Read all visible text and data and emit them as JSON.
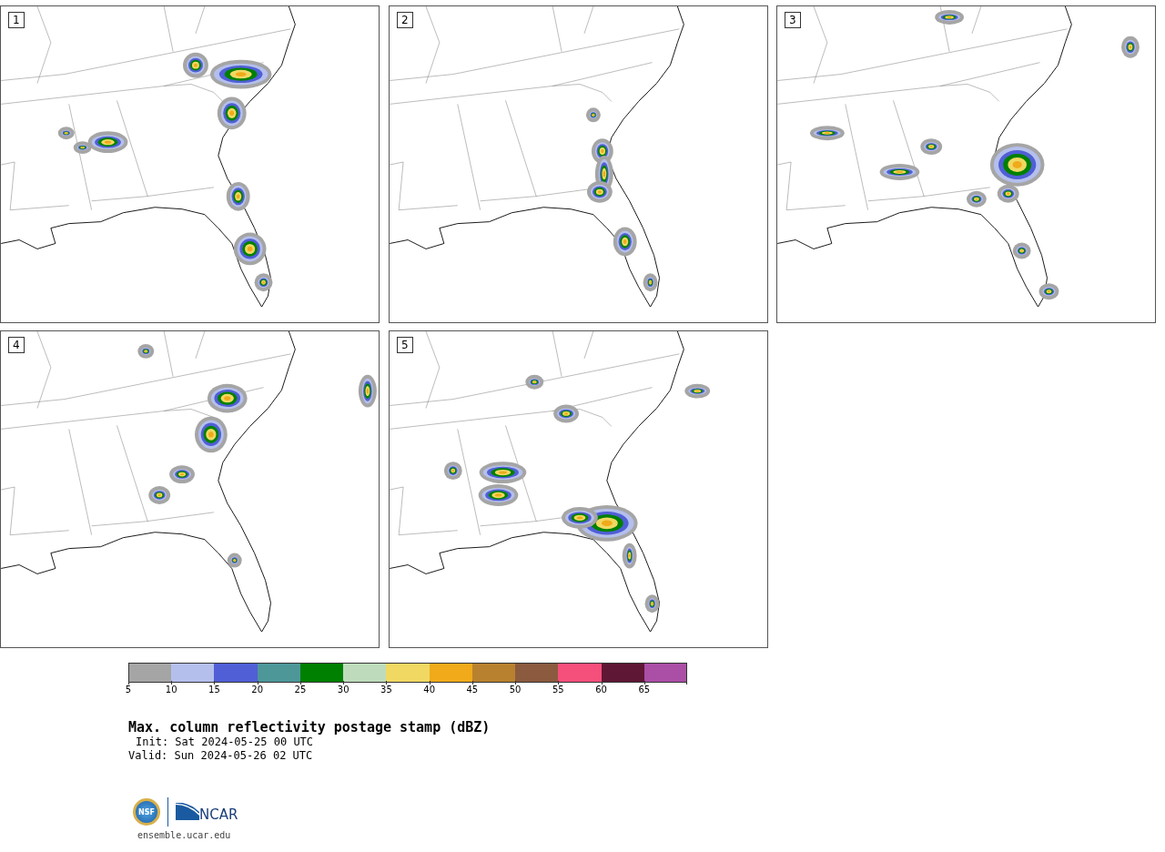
{
  "panels": [
    {
      "number": "1"
    },
    {
      "number": "2"
    },
    {
      "number": "3"
    },
    {
      "number": "4"
    },
    {
      "number": "5"
    }
  ],
  "colorbar": {
    "segments": [
      {
        "color": "#a5a5a5"
      },
      {
        "color": "#b4bfec"
      },
      {
        "color": "#505fd6"
      },
      {
        "color": "#4e9799"
      },
      {
        "color": "#008000"
      },
      {
        "color": "#bedcbb"
      },
      {
        "color": "#f0d862"
      },
      {
        "color": "#f0aa1a"
      },
      {
        "color": "#b8812f"
      },
      {
        "color": "#8b5a3f"
      },
      {
        "color": "#f54f7b"
      },
      {
        "color": "#5e1734"
      },
      {
        "color": "#aa4ea6"
      }
    ],
    "tick_labels": [
      "5",
      "10",
      "15",
      "20",
      "25",
      "30",
      "35",
      "40",
      "45",
      "50",
      "55",
      "60",
      "65"
    ]
  },
  "title": "Max. column reflectivity postage stamp (dBZ)",
  "init": "Init: Sat 2024-05-25 00 UTC",
  "valid": "Valid: Sun 2024-05-26 02 UTC",
  "logos": {
    "nsf": "NSF",
    "ncar": "NCAR"
  },
  "footer": "ensemble.ucar.edu"
}
